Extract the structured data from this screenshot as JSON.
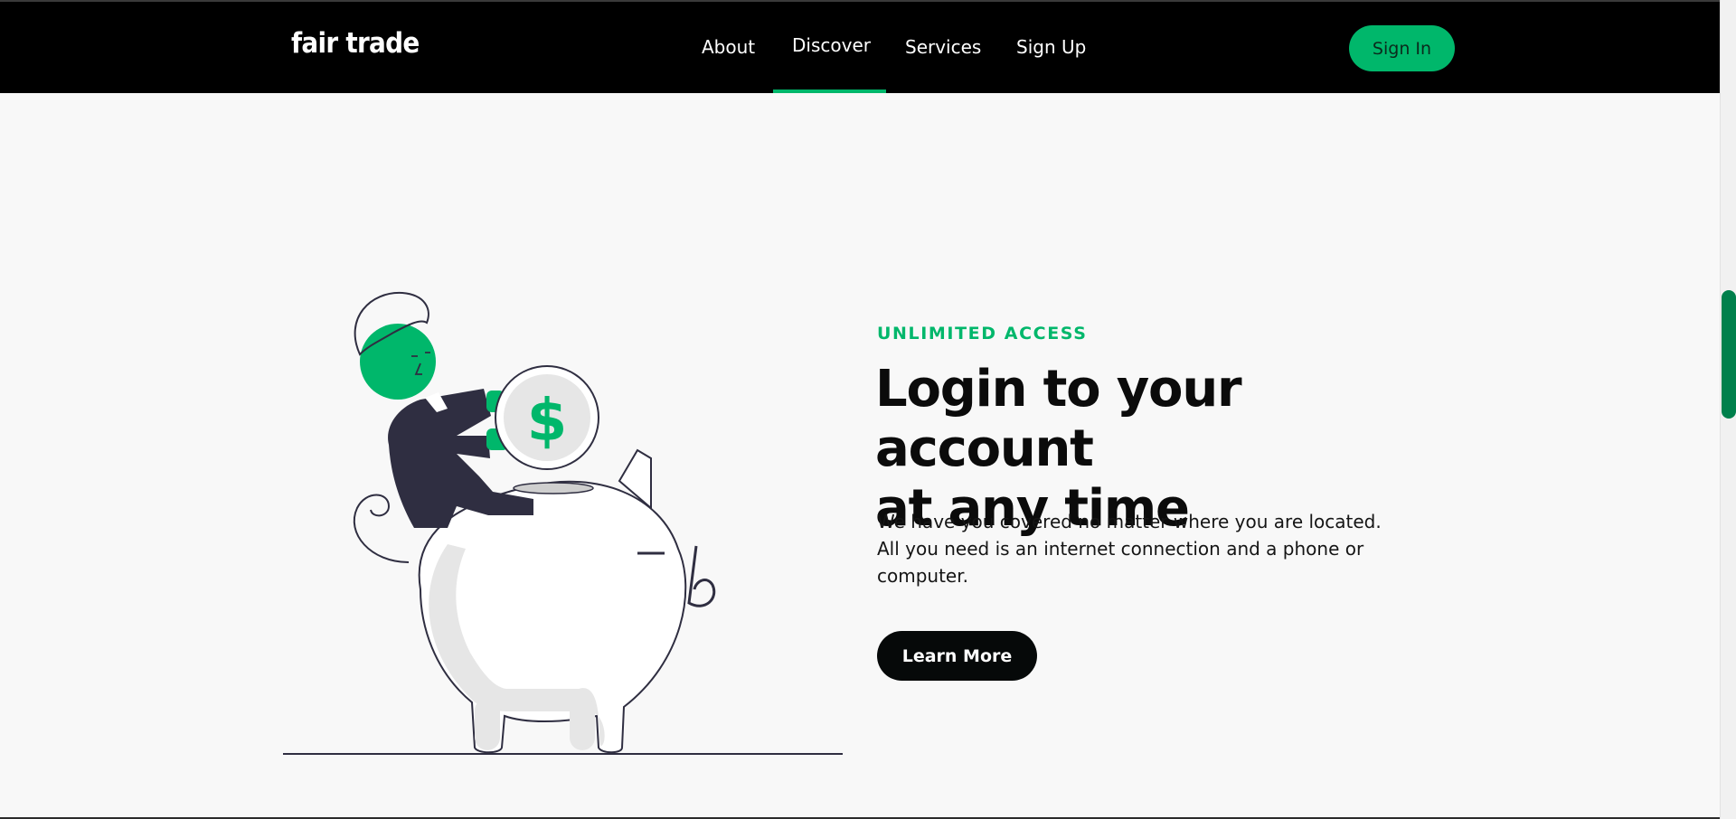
{
  "navbar": {
    "brand": "fair trade",
    "links": [
      {
        "label": "About"
      },
      {
        "label": "Discover"
      },
      {
        "label": "Services"
      },
      {
        "label": "Sign Up"
      }
    ],
    "active_link": "Discover",
    "signin_label": "Sign In"
  },
  "hero": {
    "eyebrow": "UNLIMITED ACCESS",
    "headline_line1": "Login to your account",
    "headline_line2": "at any time",
    "body_line1": "We have you covered no matter where you are located.",
    "body_line2": "All you need is an internet connection and a phone or",
    "body_line3": "computer.",
    "cta_label": "Learn More",
    "illustration": {
      "icon": "piggy-bank-illustration",
      "coin_symbol": "$"
    }
  },
  "colors": {
    "accent": "#00b76b",
    "navbar_bg": "#000000",
    "page_bg": "#f8f8f8",
    "cta_bg": "#060909",
    "illustration_dark": "#2f2e41",
    "illustration_light": "#e6e6e6"
  }
}
